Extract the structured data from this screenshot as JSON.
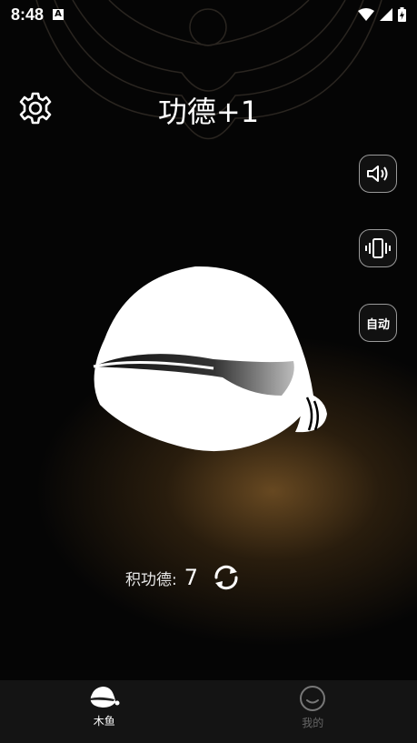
{
  "status_bar": {
    "time": "8:48",
    "notification_icon": "A"
  },
  "header": {
    "title": "功德+1"
  },
  "side_buttons": {
    "sound_icon": "speaker-icon",
    "vibrate_icon": "vibrate-icon",
    "auto_label": "自动"
  },
  "merit": {
    "label": "积功德:",
    "value": "7"
  },
  "bottom_nav": {
    "items": [
      {
        "label": "木鱼",
        "active": true
      },
      {
        "label": "我的",
        "active": false
      }
    ]
  },
  "colors": {
    "glow": "#785426",
    "nav_bg": "#141414",
    "inactive": "#666666"
  }
}
